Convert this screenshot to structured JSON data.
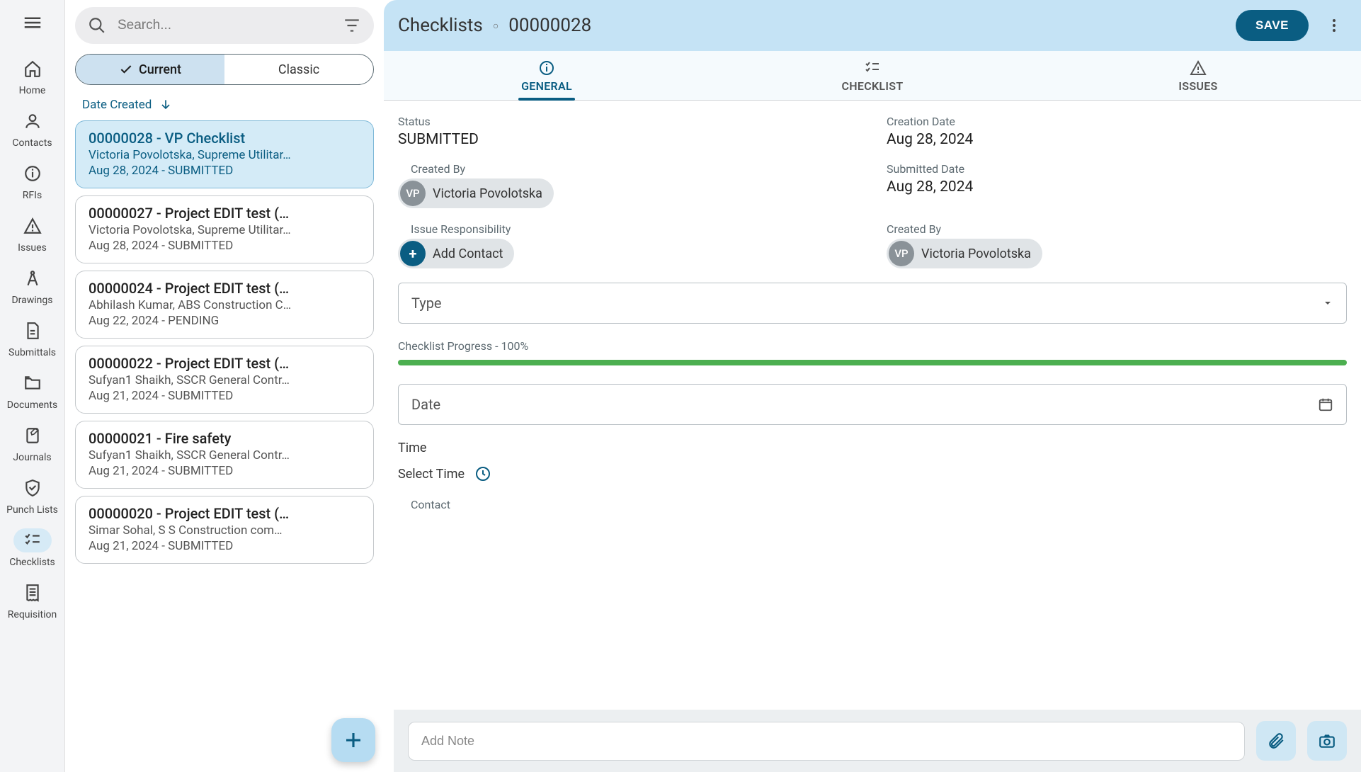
{
  "nav": {
    "items": [
      {
        "key": "home",
        "label": "Home"
      },
      {
        "key": "contacts",
        "label": "Contacts"
      },
      {
        "key": "rfis",
        "label": "RFIs"
      },
      {
        "key": "issues",
        "label": "Issues"
      },
      {
        "key": "drawings",
        "label": "Drawings"
      },
      {
        "key": "submittals",
        "label": "Submittals"
      },
      {
        "key": "documents",
        "label": "Documents"
      },
      {
        "key": "journals",
        "label": "Journals"
      },
      {
        "key": "punch-lists",
        "label": "Punch Lists"
      },
      {
        "key": "checklists",
        "label": "Checklists"
      },
      {
        "key": "requisition",
        "label": "Requisition"
      }
    ],
    "active_key": "checklists"
  },
  "search": {
    "placeholder": "Search..."
  },
  "toggle": {
    "current": "Current",
    "classic": "Classic",
    "active": "current"
  },
  "sort": {
    "label": "Date Created"
  },
  "list": [
    {
      "title": "00000028 - VP Checklist",
      "author": "Victoria Povolotska, Supreme Utilitar…",
      "meta": "Aug 28, 2024 - SUBMITTED",
      "selected": true
    },
    {
      "title": "00000027 - Project EDIT test (…",
      "author": "Victoria Povolotska, Supreme Utilitar…",
      "meta": "Aug 28, 2024 - SUBMITTED"
    },
    {
      "title": "00000024 - Project EDIT test (…",
      "author": "Abhilash Kumar, ABS Construction C…",
      "meta": "Aug 22, 2024 - PENDING"
    },
    {
      "title": "00000022 - Project EDIT test (…",
      "author": "Sufyan1 Shaikh, SSCR General Contr…",
      "meta": "Aug 21, 2024 - SUBMITTED"
    },
    {
      "title": "00000021 - Fire safety",
      "author": "Sufyan1 Shaikh, SSCR General Contr…",
      "meta": "Aug 21, 2024 - SUBMITTED"
    },
    {
      "title": "00000020 - Project EDIT test (…",
      "author": "Simar Sohal, S S Construction com…",
      "meta": "Aug 21, 2024 - SUBMITTED"
    }
  ],
  "detail": {
    "module": "Checklists",
    "id": "00000028",
    "save_label": "SAVE",
    "tabs": {
      "general": "GENERAL",
      "checklist": "CHECKLIST",
      "issues": "ISSUES",
      "active": "general"
    },
    "status_label": "Status",
    "status_value": "SUBMITTED",
    "creation_date_label": "Creation Date",
    "creation_date_value": "Aug 28, 2024",
    "submitted_date_label": "Submitted Date",
    "submitted_date_value": "Aug 28, 2024",
    "created_by_label": "Created By",
    "created_by_initials": "VP",
    "created_by_name": "Victoria Povolotska",
    "created_by_label_2": "Created By",
    "created_by_2_initials": "VP",
    "created_by_2_name": "Victoria Povolotska",
    "issue_resp_label": "Issue Responsibility",
    "add_contact_label": "Add Contact",
    "type_label": "Type",
    "progress_label": "Checklist Progress - 100%",
    "progress_pct": 100,
    "date_label": "Date",
    "time_header": "Time",
    "select_time_label": "Select Time",
    "contact_label": "Contact"
  },
  "notebar": {
    "placeholder": "Add Note"
  },
  "colors": {
    "primary": "#0a5d82",
    "header_bg": "#c5e3f5",
    "selected_bg": "#d4ebf7",
    "progress_fill": "#4caf50"
  }
}
